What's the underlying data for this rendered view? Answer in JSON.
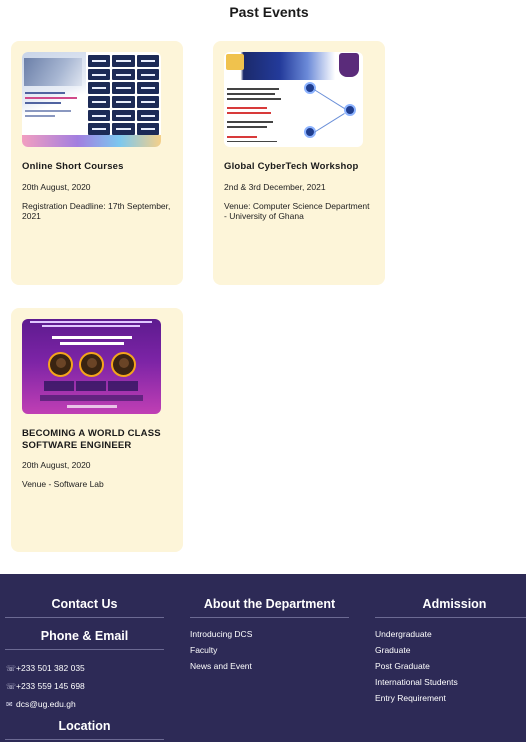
{
  "section": {
    "title": "Past Events"
  },
  "events": [
    {
      "title": "Online Short Courses",
      "date": "20th August, 2020",
      "detail": "Registration Deadline: 17th September, 2021",
      "image": "online-short-courses-poster"
    },
    {
      "title": "Global CyberTech Workshop",
      "date": "2nd & 3rd December, 2021",
      "detail": "Venue: Computer Science Department - University of Ghana",
      "image": "cybertech-workshop-poster"
    },
    {
      "title": "BECOMING A WORLD CLASS SOFTWARE ENGINEER",
      "date": "20th August, 2020",
      "detail": "Venue - Software Lab",
      "image": "software-engineer-webinar-poster"
    }
  ],
  "footer": {
    "contact_title": "Contact Us",
    "phone_email_title": "Phone & Email",
    "phones": [
      "+233 501 382 035",
      "+233 559 145 698"
    ],
    "email": "dcs@ug.edu.gh",
    "location_title": "Location",
    "about_title": "About the Department",
    "about_links": [
      "Introducing DCS",
      "Faculty",
      "News and Event"
    ],
    "admission_title": "Admission",
    "admission_links": [
      "Undergraduate",
      "Graduate",
      "Post Graduate",
      "International Students",
      "Entry Requirement"
    ],
    "colors": {
      "background": "#2d2a56",
      "card": "#fdf5d9"
    }
  }
}
